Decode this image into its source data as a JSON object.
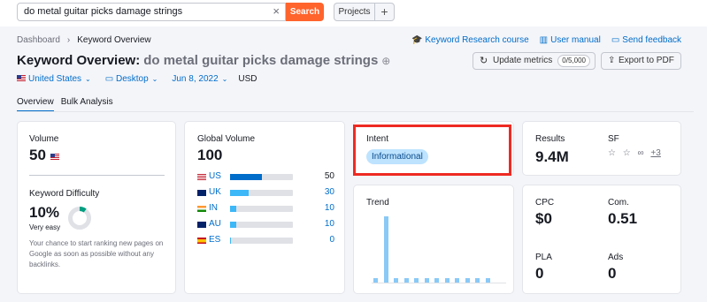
{
  "search": {
    "query": "do metal guitar picks damage strings",
    "button": "Search",
    "clear_glyph": "×"
  },
  "projects": {
    "label": "Projects",
    "add": "+"
  },
  "breadcrumb": {
    "items": [
      "Dashboard",
      "Keyword Overview"
    ]
  },
  "links": {
    "course": "Keyword Research course",
    "manual": "User manual",
    "feedback": "Send feedback"
  },
  "title": {
    "prefix": "Keyword Overview:",
    "keyword": "do metal guitar picks damage strings"
  },
  "update": {
    "label": "Update metrics",
    "count": "0/5,000"
  },
  "export": {
    "label": "Export to PDF"
  },
  "filters": {
    "country": "United States",
    "device": "Desktop",
    "date": "Jun 8, 2022",
    "currency": "USD"
  },
  "tabs": [
    "Overview",
    "Bulk Analysis"
  ],
  "volume": {
    "label": "Volume",
    "value": "50"
  },
  "difficulty": {
    "label": "Keyword Difficulty",
    "value": "10%",
    "percent": 10,
    "rating": "Very easy",
    "description": "Your chance to start ranking new pages on Google as soon as possible without any backlinks."
  },
  "global_volume": {
    "label": "Global Volume",
    "value": "100",
    "rows": [
      {
        "code": "US",
        "value": "50",
        "share": 0.5,
        "bar_color": "#006dca"
      },
      {
        "code": "UK",
        "value": "30",
        "share": 0.3,
        "bar_color": "#3cb7f8"
      },
      {
        "code": "IN",
        "value": "10",
        "share": 0.1,
        "bar_color": "#3cb7f8"
      },
      {
        "code": "AU",
        "value": "10",
        "share": 0.1,
        "bar_color": "#3cb7f8"
      },
      {
        "code": "ES",
        "value": "0",
        "share": 0.02,
        "bar_color": "#3cb7f8"
      }
    ]
  },
  "intent": {
    "label": "Intent",
    "value": "Informational"
  },
  "trend": {
    "label": "Trend",
    "values": [
      0.07,
      1.0,
      0.07,
      0.07,
      0.07,
      0.07,
      0.07,
      0.07,
      0.07,
      0.07,
      0.07,
      0.07
    ]
  },
  "results": {
    "label": "Results",
    "value": "9.4M",
    "sf_label": "SF",
    "sf_more": "+3"
  },
  "cpc": {
    "label": "CPC",
    "value": "$0"
  },
  "com": {
    "label": "Com.",
    "value": "0.51"
  },
  "pla": {
    "label": "PLA",
    "value": "0"
  },
  "ads": {
    "label": "Ads",
    "value": "0"
  },
  "colors": {
    "accent": "#ff642d",
    "link": "#006dca",
    "highlight": "#ee2a22",
    "difficulty": "#009f81"
  }
}
